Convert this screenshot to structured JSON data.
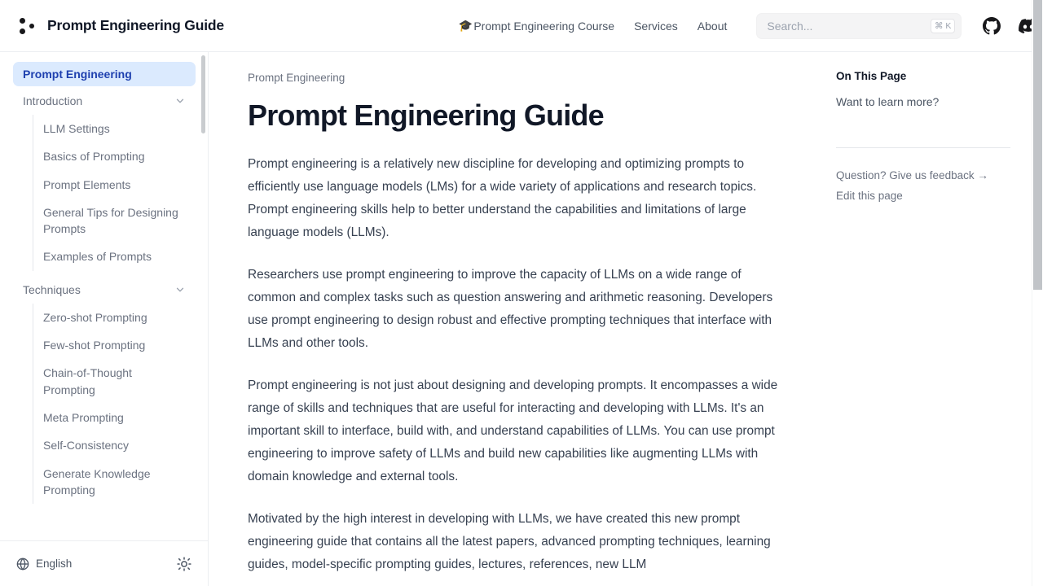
{
  "header": {
    "brand_title": "Prompt Engineering Guide",
    "logo_icon": "three-dots-logo",
    "nav": [
      {
        "label": "Prompt Engineering Course",
        "emoji": "🎓"
      },
      {
        "label": "Services",
        "emoji": ""
      },
      {
        "label": "About",
        "emoji": ""
      }
    ],
    "search": {
      "placeholder": "Search...",
      "shortcut": "⌘ K"
    },
    "social": [
      {
        "name": "github-icon"
      },
      {
        "name": "discord-icon"
      }
    ]
  },
  "sidebar": {
    "active_item": "Prompt Engineering",
    "groups": [
      {
        "label": "Introduction",
        "expanded": true,
        "items": [
          "LLM Settings",
          "Basics of Prompting",
          "Prompt Elements",
          "General Tips for Designing Prompts",
          "Examples of Prompts"
        ]
      },
      {
        "label": "Techniques",
        "expanded": true,
        "items": [
          "Zero-shot Prompting",
          "Few-shot Prompting",
          "Chain-of-Thought Prompting",
          "Meta Prompting",
          "Self-Consistency",
          "Generate Knowledge Prompting"
        ]
      }
    ],
    "footer": {
      "language": "English",
      "language_icon": "globe-icon",
      "theme_icon": "sun-icon"
    }
  },
  "content": {
    "breadcrumb": "Prompt Engineering",
    "title": "Prompt Engineering Guide",
    "paragraphs": [
      "Prompt engineering is a relatively new discipline for developing and optimizing prompts to efficiently use language models (LMs) for a wide variety of applications and research topics. Prompt engineering skills help to better understand the capabilities and limitations of large language models (LLMs).",
      "Researchers use prompt engineering to improve the capacity of LLMs on a wide range of common and complex tasks such as question answering and arithmetic reasoning. Developers use prompt engineering to design robust and effective prompting techniques that interface with LLMs and other tools.",
      "Prompt engineering is not just about designing and developing prompts. It encompasses a wide range of skills and techniques that are useful for interacting and developing with LLMs. It's an important skill to interface, build with, and understand capabilities of LLMs. You can use prompt engineering to improve safety of LLMs and build new capabilities like augmenting LLMs with domain knowledge and external tools.",
      "Motivated by the high interest in developing with LLMs, we have created this new prompt engineering guide that contains all the latest papers, advanced prompting techniques, learning guides, model-specific prompting guides, lectures, references, new LLM"
    ]
  },
  "toc": {
    "title": "On This Page",
    "links": [
      "Want to learn more?"
    ],
    "footer_links": [
      "Question? Give us feedback →",
      "Edit this page"
    ]
  },
  "colors": {
    "accent_bg": "#dbeafe",
    "accent_text": "#1e40af",
    "body_text": "#374151",
    "muted_text": "#6b7280"
  }
}
